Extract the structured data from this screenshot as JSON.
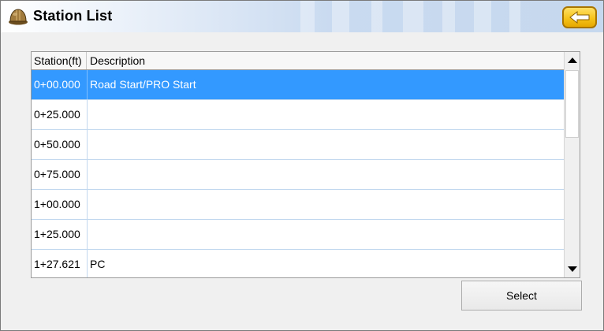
{
  "window": {
    "title": "Station List"
  },
  "colors": {
    "selected_row": "#3399ff",
    "back_button": "#f6c31a"
  },
  "icons": {
    "app": "hard-hat-icon",
    "back": "arrow-left-icon"
  },
  "table": {
    "columns": [
      "Station(ft)",
      "Description"
    ],
    "rows": [
      {
        "station": "0+00.000",
        "description": "Road Start/PRO Start",
        "selected": true
      },
      {
        "station": "0+25.000",
        "description": ""
      },
      {
        "station": "0+50.000",
        "description": ""
      },
      {
        "station": "0+75.000",
        "description": ""
      },
      {
        "station": "1+00.000",
        "description": ""
      },
      {
        "station": "1+25.000",
        "description": ""
      },
      {
        "station": "1+27.621",
        "description": "PC"
      }
    ]
  },
  "buttons": {
    "select": "Select"
  }
}
